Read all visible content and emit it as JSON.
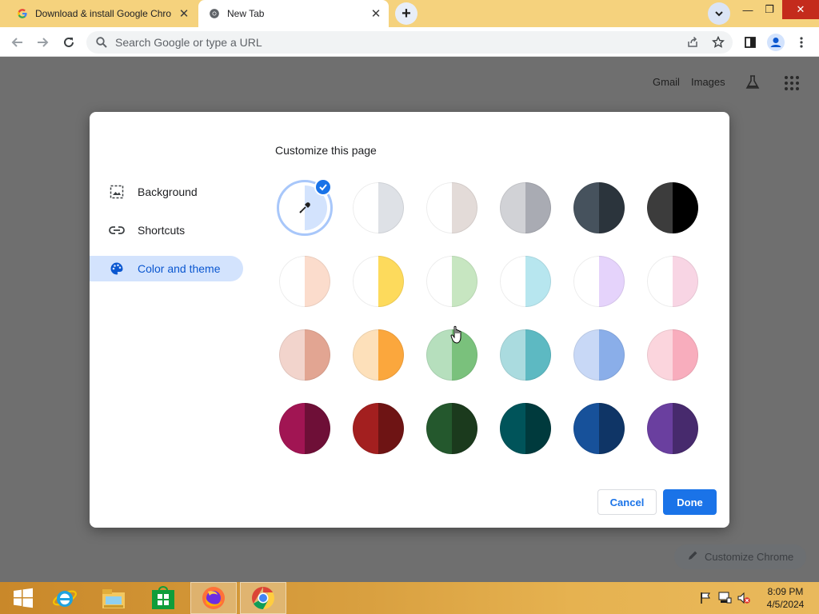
{
  "browser": {
    "tabs": [
      {
        "title": "Download & install Google Chro",
        "close": "✕",
        "active": false
      },
      {
        "title": "New Tab",
        "close": "✕",
        "active": true
      }
    ],
    "new_tab_symbol": "+",
    "window_controls": {
      "minimize": "—",
      "restore": "❐",
      "close": "✕"
    },
    "omnibox": {
      "placeholder": "Search Google or type a URL",
      "value": ""
    }
  },
  "page": {
    "links": {
      "gmail": "Gmail",
      "images": "Images"
    },
    "customize_chrome_label": "Customize Chrome"
  },
  "dialog": {
    "title": "Customize this page",
    "menu": [
      {
        "label": "Background",
        "icon": "image-icon",
        "active": false
      },
      {
        "label": "Shortcuts",
        "icon": "link-icon",
        "active": false
      },
      {
        "label": "Color and theme",
        "icon": "palette-icon",
        "active": true
      }
    ],
    "selected_theme": "custom-color",
    "theme_rows": [
      [
        {
          "left": "#ffffff",
          "right": "#d3e3fd",
          "custom": true
        },
        {
          "left": "#ffffff",
          "right": "#dee1e6"
        },
        {
          "left": "#ffffff",
          "right": "#e3dbd8"
        },
        {
          "left": "#d1d2d6",
          "right": "#a9abb3"
        },
        {
          "left": "#46525d",
          "right": "#2b343c"
        },
        {
          "left": "#3c3c3c",
          "right": "#000000"
        }
      ],
      [
        {
          "left": "#ffffff",
          "right": "#fbdccc"
        },
        {
          "left": "#ffffff",
          "right": "#fdda5c"
        },
        {
          "left": "#ffffff",
          "right": "#c7e6c1"
        },
        {
          "left": "#ffffff",
          "right": "#b7e6ef"
        },
        {
          "left": "#ffffff",
          "right": "#e5d3fb"
        },
        {
          "left": "#ffffff",
          "right": "#f8d5e4"
        }
      ],
      [
        {
          "left": "#f2d4cc",
          "right": "#e2a592"
        },
        {
          "left": "#fde0ba",
          "right": "#fba73d"
        },
        {
          "left": "#b6dfbd",
          "right": "#7ac17c"
        },
        {
          "left": "#aadbdf",
          "right": "#5db9c2"
        },
        {
          "left": "#c8d8f6",
          "right": "#8aaee9"
        },
        {
          "left": "#fbd5dd",
          "right": "#f8adbd"
        }
      ],
      [
        {
          "left": "#a11553",
          "right": "#6e0f37"
        },
        {
          "left": "#a31f1f",
          "right": "#6e1414"
        },
        {
          "left": "#24582d",
          "right": "#1b3a1d"
        },
        {
          "left": "#00545a",
          "right": "#003a3d"
        },
        {
          "left": "#17519a",
          "right": "#0f3566"
        },
        {
          "left": "#6a3f9f",
          "right": "#472a6d"
        }
      ]
    ],
    "buttons": {
      "cancel": "Cancel",
      "done": "Done"
    }
  },
  "taskbar": {
    "apps": [
      "start-icon",
      "internet-explorer-icon",
      "file-explorer-icon",
      "store-icon",
      "firefox-icon",
      "chrome-icon"
    ],
    "clock": {
      "time": "8:09 PM",
      "date": "4/5/2024"
    }
  },
  "colors": {
    "accent": "#1a73e8",
    "tabstrip": "#f5d27d",
    "taskbar": "#d9a040"
  }
}
